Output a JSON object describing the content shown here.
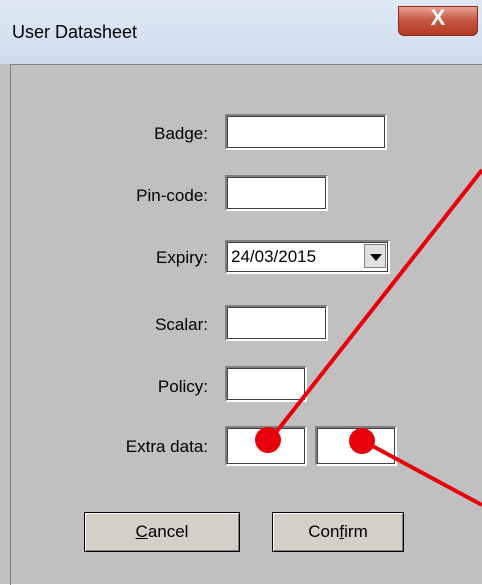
{
  "window": {
    "title": "User Datasheet",
    "close_glyph": "X"
  },
  "form": {
    "badge_label": "Badge:",
    "badge_value": "",
    "pincode_label": "Pin-code:",
    "pincode_value": "",
    "expiry_label": "Expiry:",
    "expiry_value": "24/03/2015",
    "scalar_label": "Scalar:",
    "scalar_value": "",
    "policy_label": "Policy:",
    "policy_value": "",
    "extra_label": "Extra data:",
    "extra1_value": "",
    "extra2_value": ""
  },
  "buttons": {
    "cancel_mnemonic": "C",
    "cancel_rest": "ancel",
    "confirm_pre": "Con",
    "confirm_mnemonic": "f",
    "confirm_rest": "irm"
  },
  "annotation": {
    "color": "#e8000b"
  }
}
